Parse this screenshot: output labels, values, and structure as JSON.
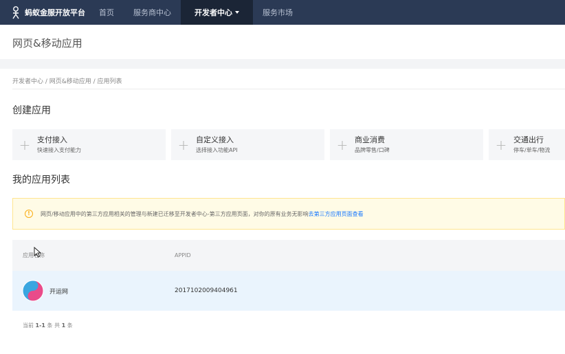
{
  "topnav": {
    "brand": "蚂蚁金服开放平台",
    "items": [
      {
        "label": "首页"
      },
      {
        "label": "服务商中心"
      },
      {
        "label": "开发者中心"
      },
      {
        "label": "服务市场"
      }
    ]
  },
  "page": {
    "title": "网页&移动应用"
  },
  "breadcrumb": "开发者中心 / 网页&移动应用 / 应用列表",
  "create": {
    "title": "创建应用",
    "cards": [
      {
        "title": "支付接入",
        "sub": "快速接入支付能力"
      },
      {
        "title": "自定义接入",
        "sub": "选择接入功能API"
      },
      {
        "title": "商业消费",
        "sub": "品牌零售/口碑"
      },
      {
        "title": "交通出行",
        "sub": "停车/单车/物流"
      }
    ]
  },
  "my_apps": {
    "title": "我的应用列表",
    "notice_text": "网页/移动应用中的第三方应用相关的管理与新建已迁移至开发者中心-第三方应用页面，对你的原有业务无影响",
    "notice_link": "去第三方应用页面查看",
    "columns": {
      "name": "应用名称",
      "appid": "APPID"
    },
    "rows": [
      {
        "name": "开运网",
        "appid": "2017102009404961"
      }
    ],
    "pagination": {
      "prefix": "当前",
      "range": "1-1",
      "mid": "条 共",
      "total": "1",
      "suffix": "条"
    }
  },
  "colors": {
    "nav_bg": "#2b3a55",
    "nav_active": "#1b2536",
    "link": "#1677ff",
    "notice_bg": "#fffbe6",
    "notice_border": "#ffe58f",
    "row_selected": "#eaf4fd"
  },
  "icons": {
    "brand": "ant-logo-icon",
    "card": "plus-icon",
    "notice": "info-circle-icon",
    "avatar": "app-avatar-icon",
    "cursor": "mouse-cursor-icon"
  }
}
